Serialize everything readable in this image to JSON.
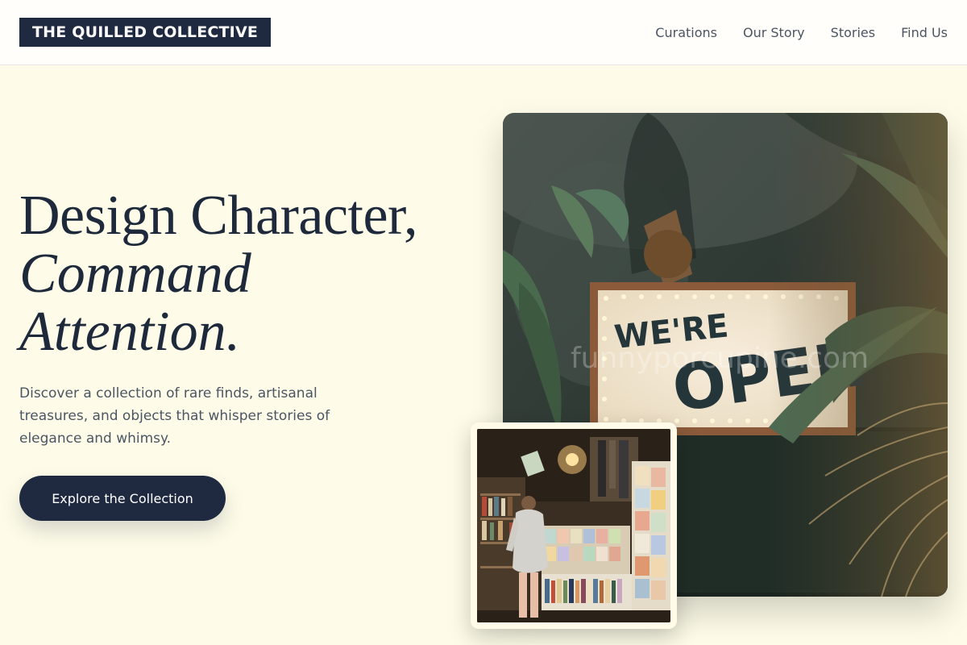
{
  "header": {
    "logo_text": "THE QUILLED COLLECTIVE",
    "nav": [
      {
        "label": "Curations"
      },
      {
        "label": "Our Story"
      },
      {
        "label": "Stories"
      },
      {
        "label": "Find Us"
      }
    ]
  },
  "hero": {
    "title_line1": "Design Character,",
    "title_line2": "Command",
    "title_line3": "Attention.",
    "description": "Discover a collection of rare finds, artisanal treasures, and objects that whisper stories of elegance and whimsy.",
    "cta_label": "Explore the Collection"
  },
  "images": {
    "main_sign_text_1": "WE'RE",
    "main_sign_text_2": "OPEN",
    "watermark": "funnyporcupine.com"
  },
  "colors": {
    "page_bg": "#fefce8",
    "brand_dark": "#1f2a40",
    "text_muted": "#4b5563"
  }
}
